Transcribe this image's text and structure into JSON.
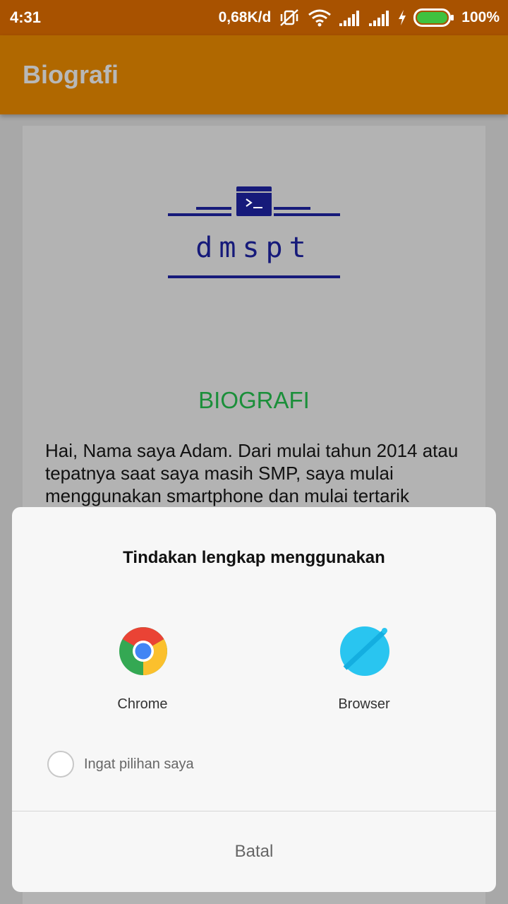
{
  "status_bar": {
    "time": "4:31",
    "network_speed": "0,68K/d",
    "battery_percent": "100%",
    "icons": [
      "vibrate-off-icon",
      "wifi-icon",
      "signal-icon",
      "signal-icon",
      "charging-icon",
      "battery-icon"
    ],
    "battery_color": "#3fc23f"
  },
  "app_bar": {
    "title": "Biografi",
    "color": "#b06800"
  },
  "content": {
    "logo_text": "dmspt",
    "logo_color": "#161a7a",
    "heading": "BIOGRAFI",
    "heading_color": "#1b8f3a",
    "paragraph": "Hai, Nama saya Adam. Dari mulai tahun 2014 atau tepatnya saat saya masih SMP, saya mulai menggunakan smartphone dan mulai tertarik"
  },
  "dialog": {
    "title": "Tindakan lengkap menggunakan",
    "options": [
      {
        "label": "Chrome",
        "icon": "chrome-icon"
      },
      {
        "label": "Browser",
        "icon": "browser-icon"
      }
    ],
    "remember_label": "Ingat pilihan saya",
    "remember_checked": false,
    "cancel_label": "Batal"
  }
}
